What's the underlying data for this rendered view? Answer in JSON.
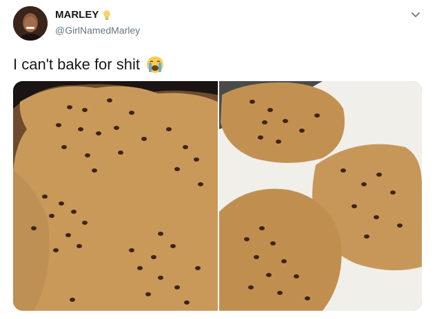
{
  "tweet": {
    "display_name": "MARLEY",
    "handle": "@GirlNamedMarley",
    "text": "I can't bake for shit",
    "emoji": "crying-face",
    "icons": {
      "name_badge": "lightbulb-icon",
      "menu": "chevron-down-icon"
    },
    "media": [
      {
        "name": "photo-cookie-large"
      },
      {
        "name": "photo-cookie-plate"
      }
    ]
  },
  "colors": {
    "text": "#14171a",
    "secondary": "#657786",
    "cookie": "#c89a5a",
    "chip": "#3a2417"
  }
}
